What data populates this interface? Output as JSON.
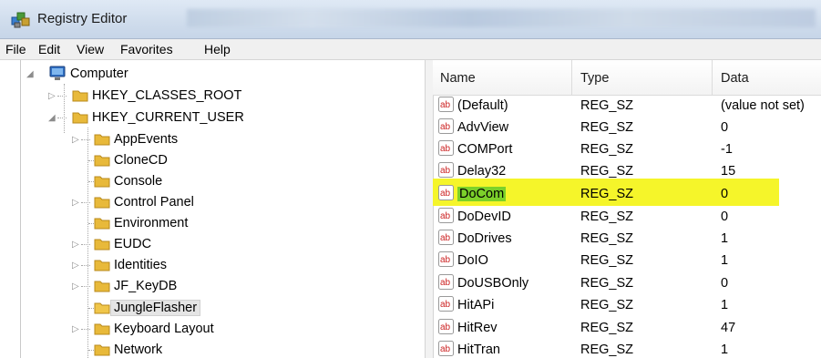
{
  "window": {
    "title": "Registry Editor"
  },
  "menu": [
    "File",
    "Edit",
    "View",
    "Favorites",
    "Help"
  ],
  "tree": {
    "computer": "Computer",
    "hkcr": "HKEY_CLASSES_ROOT",
    "hkcu": "HKEY_CURRENT_USER",
    "children": [
      "AppEvents",
      "CloneCD",
      "Console",
      "Control Panel",
      "Environment",
      "EUDC",
      "Identities",
      "JF_KeyDB",
      "JungleFlasher",
      "Keyboard Layout",
      "Network"
    ],
    "selected": "JungleFlasher"
  },
  "list": {
    "columns": {
      "name": "Name",
      "type": "Type",
      "data": "Data"
    },
    "rows": [
      {
        "name": "(Default)",
        "type": "REG_SZ",
        "data": "(value not set)"
      },
      {
        "name": "AdvView",
        "type": "REG_SZ",
        "data": "0"
      },
      {
        "name": "COMPort",
        "type": "REG_SZ",
        "data": "-1"
      },
      {
        "name": "Delay32",
        "type": "REG_SZ",
        "data": "15"
      },
      {
        "name": "DoCom",
        "type": "REG_SZ",
        "data": "0"
      },
      {
        "name": "DoDevID",
        "type": "REG_SZ",
        "data": "0"
      },
      {
        "name": "DoDrives",
        "type": "REG_SZ",
        "data": "1"
      },
      {
        "name": "DoIO",
        "type": "REG_SZ",
        "data": "1"
      },
      {
        "name": "DoUSBOnly",
        "type": "REG_SZ",
        "data": "0"
      },
      {
        "name": "HitAPi",
        "type": "REG_SZ",
        "data": "1"
      },
      {
        "name": "HitRev",
        "type": "REG_SZ",
        "data": "47"
      },
      {
        "name": "HitTran",
        "type": "REG_SZ",
        "data": "1"
      }
    ],
    "highlighted_row": "DoCom"
  },
  "colors": {
    "highlight_row": "#f5f52a",
    "highlight_name": "#7cd12a",
    "folder": "#e8b93a"
  },
  "icons": {
    "app": "registry-editor-icon",
    "value": "ab-string-value-icon",
    "folder": "folder-icon",
    "computer": "computer-icon"
  }
}
